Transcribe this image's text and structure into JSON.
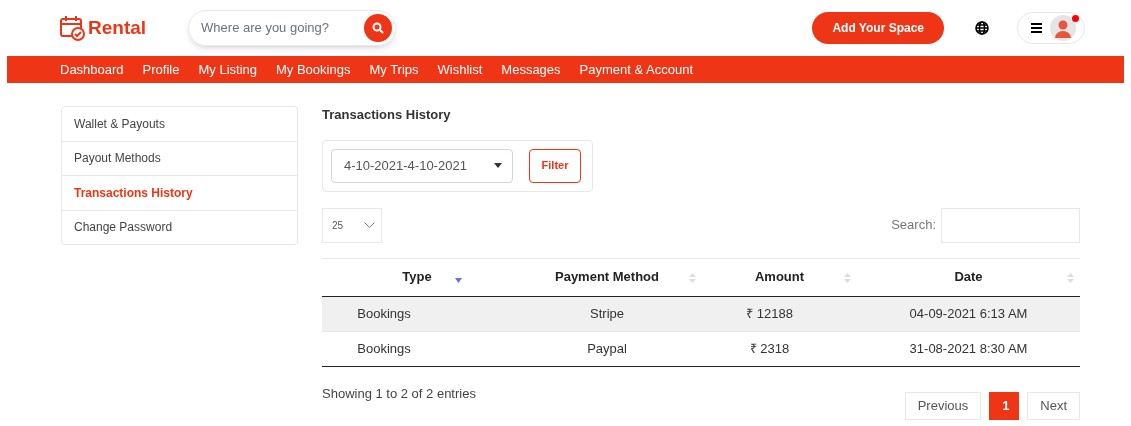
{
  "header": {
    "logo": "Rental",
    "search": {
      "placeholder": "Where are you going?"
    },
    "cta": "Add Your Space",
    "notification": true
  },
  "nav": [
    "Dashboard",
    "Profile",
    "My Listing",
    "My Bookings",
    "My Trips",
    "Wishlist",
    "Messages",
    "Payment & Account"
  ],
  "sidebar": {
    "items": [
      {
        "label": "Wallet & Payouts",
        "selected": false
      },
      {
        "label": "Payout Methods",
        "selected": false
      },
      {
        "label": "Transactions History",
        "selected": true
      },
      {
        "label": "Change Password",
        "selected": false
      }
    ]
  },
  "main": {
    "title": "Transactions History",
    "date_range": "4-10-2021-4-10-2021",
    "filter_button": "Filter",
    "page_size": "25",
    "search_label": "Search:",
    "table": {
      "columns": [
        {
          "label": "Type",
          "sorted": true
        },
        {
          "label": "Payment Method",
          "sorted": false
        },
        {
          "label": "Amount",
          "sorted": false
        },
        {
          "label": "Date",
          "sorted": false
        }
      ],
      "rows": [
        {
          "cells": [
            "Bookings",
            "Stripe",
            "₹ 12188",
            "04-09-2021 6:13 AM"
          ],
          "selected": true
        },
        {
          "cells": [
            "Bookings",
            "Paypal",
            "₹ 2318",
            "31-08-2021 8:30 AM"
          ],
          "selected": false
        }
      ]
    },
    "info": "Showing 1 to 2 of 2 entries",
    "pagination": [
      {
        "label": "Previous",
        "selected": false
      },
      {
        "label": "1",
        "selected": true
      },
      {
        "label": "Next",
        "selected": false
      }
    ]
  }
}
